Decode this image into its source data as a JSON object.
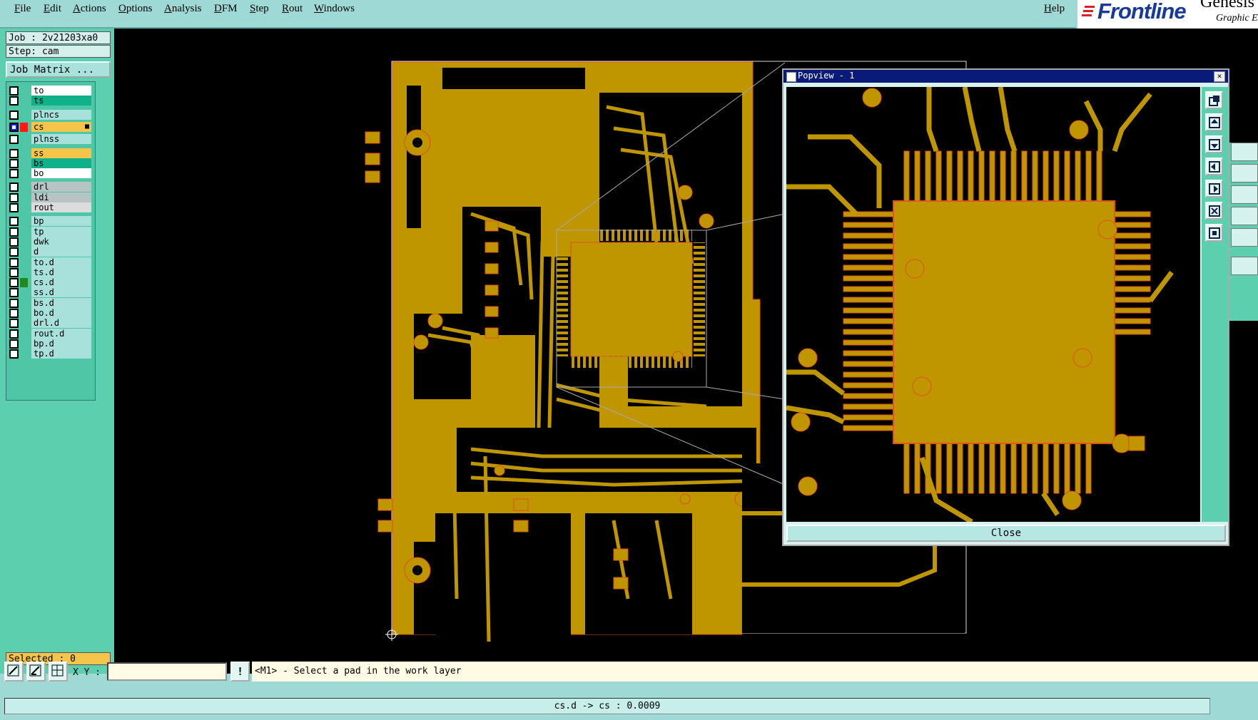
{
  "menu": {
    "items": [
      "File",
      "Edit",
      "Actions",
      "Options",
      "Analysis",
      "DFM",
      "Step",
      "Rout",
      "Windows"
    ],
    "help": "Help"
  },
  "brand": {
    "name": "Frontline",
    "product": "Genesis",
    "tagline": "Graphic E"
  },
  "job": {
    "job_label": "Job : 2v21203xa0",
    "step_label": "Step: cam",
    "matrix_button": "Job Matrix ..."
  },
  "layers": [
    {
      "name": "to",
      "color": "#ffffff",
      "checked": false
    },
    {
      "name": "ts",
      "color": "#10b08a",
      "checked": false
    },
    {
      "name": "plncs",
      "color": "#a8e0dc",
      "checked": false
    },
    {
      "name": "cs",
      "color": "#f5c44a",
      "checked": true,
      "swatch": "#ff1a1a",
      "mark": "■"
    },
    {
      "name": "plnss",
      "color": "#a8e0dc",
      "checked": false
    },
    {
      "name": "ss",
      "color": "#f5c44a",
      "checked": false
    },
    {
      "name": "bs",
      "color": "#10b08a",
      "checked": false
    },
    {
      "name": "bo",
      "color": "#ffffff",
      "checked": false
    },
    {
      "name": "drl",
      "color": "#b8c4c4",
      "checked": false
    },
    {
      "name": "ldi",
      "color": "#b8c4c4",
      "checked": false
    },
    {
      "name": "rout",
      "color": "#dcdcdc",
      "checked": false
    },
    {
      "name": "bp",
      "color": "#a8e0dc",
      "checked": false
    },
    {
      "name": "tp",
      "color": "#a8e0dc",
      "checked": false
    },
    {
      "name": "dwk",
      "color": "#a8e0dc",
      "checked": false
    },
    {
      "name": "d",
      "color": "#a8e0dc",
      "checked": false
    },
    {
      "name": "to.d",
      "color": "#a8e0dc",
      "checked": false
    },
    {
      "name": "ts.d",
      "color": "#a8e0dc",
      "checked": false
    },
    {
      "name": "cs.d",
      "color": "#a8e0dc",
      "checked": false,
      "swatch": "#1f8a1f"
    },
    {
      "name": "ss.d",
      "color": "#a8e0dc",
      "checked": false
    },
    {
      "name": "bs.d",
      "color": "#a8e0dc",
      "checked": false
    },
    {
      "name": "bo.d",
      "color": "#a8e0dc",
      "checked": false
    },
    {
      "name": "drl.d",
      "color": "#a8e0dc",
      "checked": false
    },
    {
      "name": "rout.d",
      "color": "#a8e0dc",
      "checked": false
    },
    {
      "name": "bp.d",
      "color": "#a8e0dc",
      "checked": false
    },
    {
      "name": "tp.d",
      "color": "#a8e0dc",
      "checked": false
    }
  ],
  "selected_label": "Selected : 0",
  "popview": {
    "title": "Popview - 1",
    "close_label": "Close",
    "close_x": "✕"
  },
  "toolbar": {
    "xy_label": "X Y :",
    "xy_value": "",
    "prompt_icon": "!",
    "prompt": "<M1> - Select a pad in the work layer"
  },
  "status": "cs.d -> cs : 0.0009",
  "colors": {
    "copper": "#bf9600",
    "background": "#000000",
    "trace_edge": "#e05018",
    "panel": "#5ccfaf"
  }
}
